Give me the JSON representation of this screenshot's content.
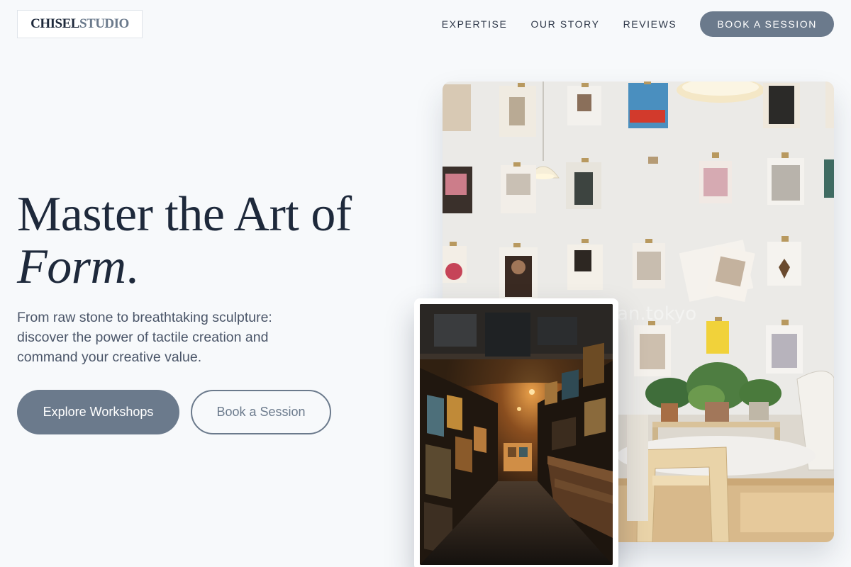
{
  "brand": {
    "name_primary": "CHISEL",
    "name_secondary": "STUDIO"
  },
  "nav": {
    "links": [
      "EXPERTISE",
      "OUR STORY",
      "REVIEWS"
    ],
    "cta": "BOOK A SESSION"
  },
  "hero": {
    "title_line1": "Master the Art of",
    "title_line2": "Form",
    "title_punct": ".",
    "subtitle": "From raw stone to breathtaking sculpture: discover the power of tactile creation and command your creative value.",
    "primary_button": "Explore Workshops",
    "secondary_button": "Book a Session"
  },
  "images": {
    "main": {
      "description": "Cafe wall with magazines on clipboards, pendant lamp, plants and table"
    },
    "inset": {
      "description": "Dim corridor of an art shop lined with framed paintings"
    }
  },
  "colors": {
    "background": "#f7f9fb",
    "text_dark": "#1e293b",
    "accent": "#6b7a8c"
  }
}
